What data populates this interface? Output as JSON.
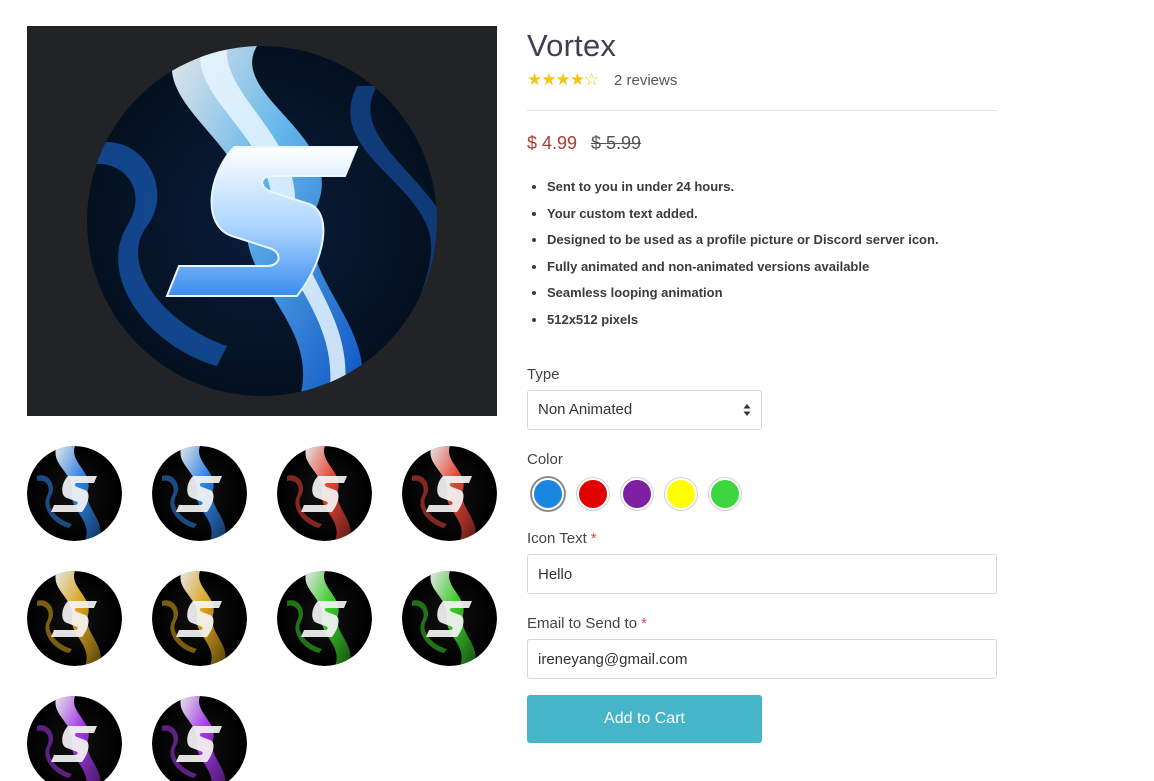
{
  "product": {
    "title": "Vortex",
    "rating_stars": "★★★★☆",
    "rating_value": 4,
    "reviews_text": "2 reviews",
    "price": "$ 4.99",
    "compare_price": "$ 5.99",
    "features": [
      "Sent to you in under 24 hours.",
      "Your custom text added.",
      "Designed to be used as a profile picture or Discord server icon.",
      "Fully animated and non-animated versions available",
      "Seamless looping animation",
      "512x512 pixels"
    ]
  },
  "gallery": {
    "main_icon": "vortex-s-logo-blue",
    "thumbnails": [
      {
        "color": "#2f8fff",
        "name": "blue"
      },
      {
        "color": "#2f8fff",
        "name": "blue"
      },
      {
        "color": "#ff4a3a",
        "name": "red"
      },
      {
        "color": "#ff4a3a",
        "name": "red"
      },
      {
        "color": "#f2b51c",
        "name": "gold"
      },
      {
        "color": "#f2b51c",
        "name": "gold"
      },
      {
        "color": "#3ee02a",
        "name": "green"
      },
      {
        "color": "#3ee02a",
        "name": "green"
      },
      {
        "color": "#b13cff",
        "name": "purple"
      },
      {
        "color": "#b13cff",
        "name": "purple"
      }
    ]
  },
  "options": {
    "type_label": "Type",
    "type_value": "Non Animated",
    "color_label": "Color",
    "colors": [
      "#1a86e0",
      "#e00000",
      "#7d1fa0",
      "#ffff00",
      "#3ed63e"
    ],
    "selected_color_index": 0,
    "icon_text_label": "Icon Text",
    "icon_text_value": "Hello",
    "email_label": "Email to Send to",
    "email_value": "ireneyang@gmail.com",
    "required_mark": "*"
  },
  "actions": {
    "add_to_cart": "Add to Cart"
  }
}
